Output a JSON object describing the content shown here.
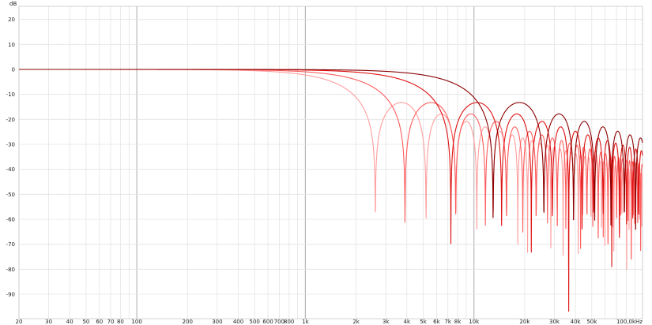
{
  "chart_data": {
    "type": "line",
    "title": "",
    "ylabel": "dB",
    "xlabel": "",
    "x_scale": "log",
    "xlim": [
      20,
      100000
    ],
    "ylim": [
      -97,
      25
    ],
    "grid": true,
    "legend": "none",
    "x_ticks": [
      {
        "value": 20,
        "label": "20"
      },
      {
        "value": 30,
        "label": "30"
      },
      {
        "value": 40,
        "label": "40"
      },
      {
        "value": 50,
        "label": "50"
      },
      {
        "value": 60,
        "label": "60"
      },
      {
        "value": 70,
        "label": "70"
      },
      {
        "value": 80,
        "label": "80"
      },
      {
        "value": 100,
        "label": "100"
      },
      {
        "value": 200,
        "label": "200"
      },
      {
        "value": 300,
        "label": "300"
      },
      {
        "value": 400,
        "label": "400"
      },
      {
        "value": 500,
        "label": "500"
      },
      {
        "value": 600,
        "label": "600"
      },
      {
        "value": 700,
        "label": "700"
      },
      {
        "value": 800,
        "label": "800"
      },
      {
        "value": 1000,
        "label": "1k"
      },
      {
        "value": 2000,
        "label": "2k"
      },
      {
        "value": 3000,
        "label": "3k"
      },
      {
        "value": 4000,
        "label": "4k"
      },
      {
        "value": 5000,
        "label": "5k"
      },
      {
        "value": 6000,
        "label": "6k"
      },
      {
        "value": 7000,
        "label": "7k"
      },
      {
        "value": 8000,
        "label": "8k"
      },
      {
        "value": 10000,
        "label": "10k"
      },
      {
        "value": 20000,
        "label": "20k"
      },
      {
        "value": 30000,
        "label": "30k"
      },
      {
        "value": 40000,
        "label": "40k"
      },
      {
        "value": 50000,
        "label": "50k"
      },
      {
        "value": 100000,
        "label": "100,0kHz"
      }
    ],
    "y_ticks": [
      20,
      10,
      0,
      -10,
      -20,
      -30,
      -40,
      -50,
      -60,
      -70,
      -80,
      -90
    ],
    "major_x_gridlines": [
      100,
      1000,
      10000
    ],
    "series": [
      {
        "color": "#ff9e9e",
        "first_null_hz": 2600,
        "nulls_hz": [
          2600,
          5200,
          7800,
          10400,
          13000,
          15600
        ],
        "sidelobe_peak_db": -17.8
      },
      {
        "color": "#ff5c5c",
        "first_null_hz": 3900,
        "nulls_hz": [
          3900,
          7800,
          11700,
          15600,
          19500
        ],
        "sidelobe_peak_db": -17.8
      },
      {
        "color": "#dd1111",
        "first_null_hz": 7300,
        "nulls_hz": [
          7300,
          14600,
          21900,
          29200
        ],
        "sidelobe_peak_db": -17.8
      },
      {
        "color": "#8b0000",
        "first_null_hz": 13000,
        "nulls_hz": [
          13000,
          26000,
          39000,
          52000
        ],
        "sidelobe_peak_db": -17.8
      }
    ]
  }
}
